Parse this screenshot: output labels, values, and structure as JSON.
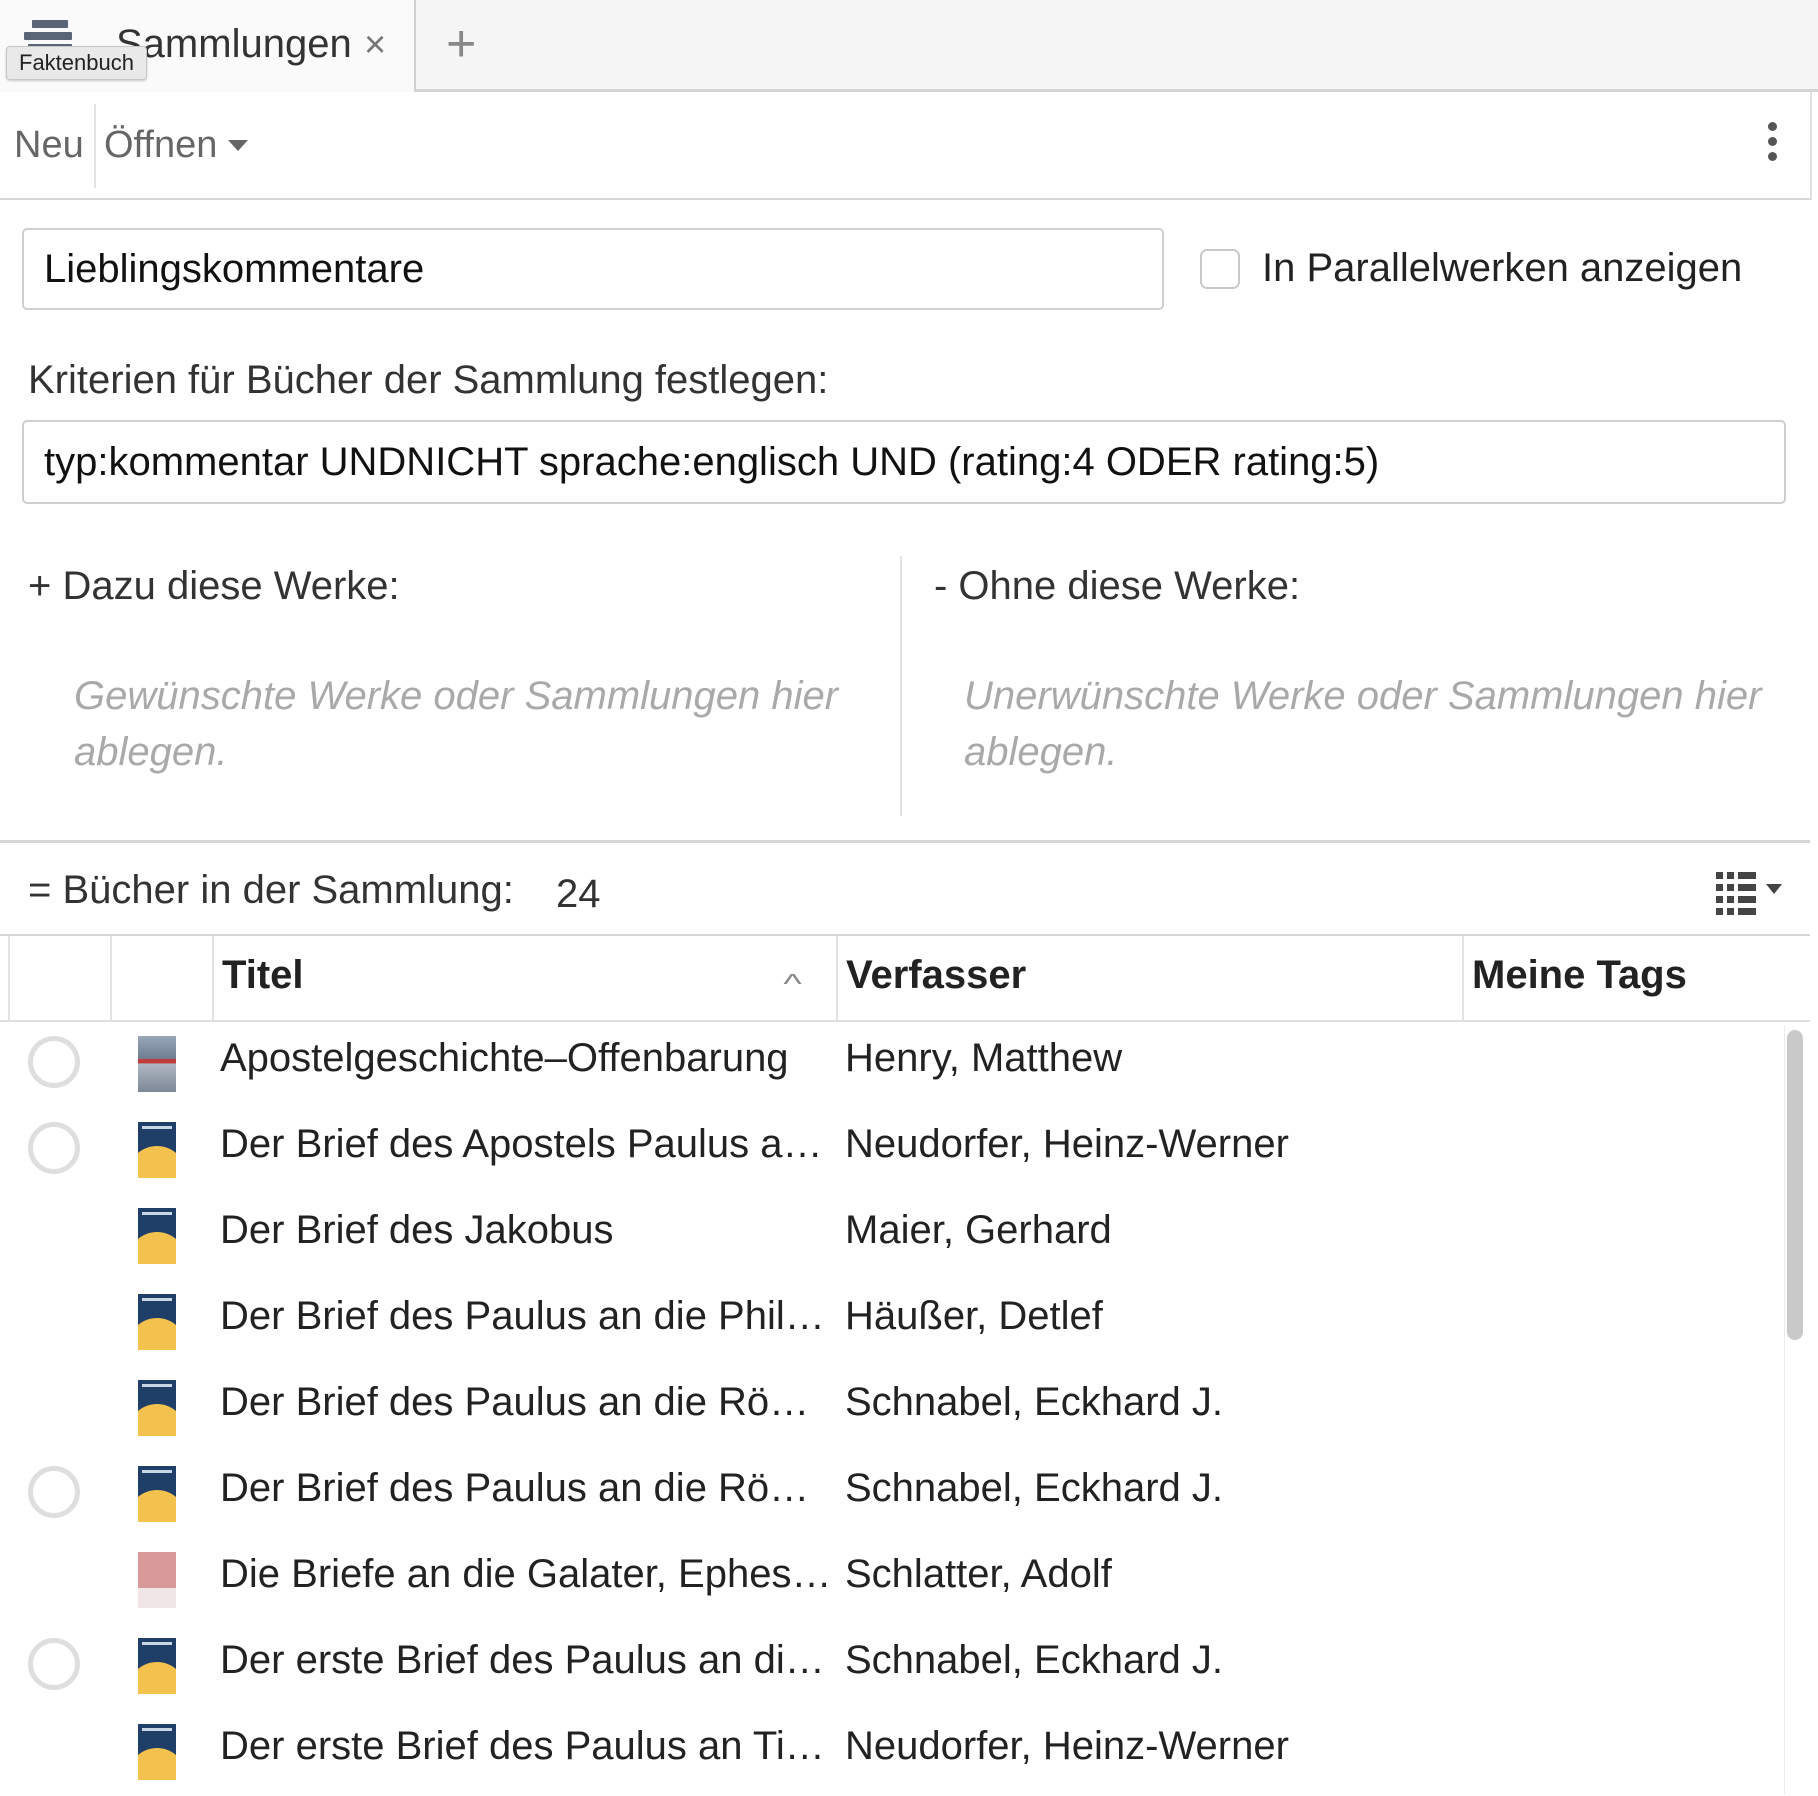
{
  "tab": {
    "icon": "books-icon",
    "label": "Sammlungen",
    "close_glyph": "×",
    "tooltip": "Faktenbuch",
    "add_glyph": "+"
  },
  "toolbar": {
    "new_label": "Neu",
    "open_label": "Öffnen",
    "more_icon": "kebab-menu-icon"
  },
  "collection": {
    "name": "Lieblingskommentare",
    "parallel_label": "In Parallelwerken anzeigen",
    "parallel_checked": false,
    "criteria_label": "Kriterien  für Bücher der Sammlung festlegen:",
    "criteria_value": "typ:kommentar UNDNICHT sprache:englisch UND (rating:4 ODER rating:5)"
  },
  "include": {
    "heading": "+ Dazu diese Werke:",
    "placeholder": "Gewünschte Werke oder Sammlungen hier ablegen."
  },
  "exclude": {
    "heading": "-  Ohne diese Werke:",
    "placeholder": "Unerwünschte Werke oder Sammlungen hier ablegen."
  },
  "books": {
    "label": "= Bücher in der Sammlung:",
    "count": "24",
    "view_icon": "list-view-icon"
  },
  "table": {
    "columns": [
      "Titel",
      "Verfasser",
      "Meine Tags"
    ],
    "sort_indicator": "^",
    "rows": [
      {
        "title": "Apostelgeschichte–Offenbarung",
        "author": "Henry, Matthew",
        "status": true,
        "cover": "photo"
      },
      {
        "title": "Der Brief des Apostels Paulus a…",
        "author": "Neudorfer, Heinz-Werner",
        "status": true,
        "cover": "blue"
      },
      {
        "title": "Der Brief des Jakobus",
        "author": "Maier, Gerhard",
        "status": false,
        "cover": "blue"
      },
      {
        "title": "Der Brief des Paulus an die Phil…",
        "author": "Häußer, Detlef",
        "status": false,
        "cover": "blue"
      },
      {
        "title": "Der Brief des Paulus an die Rö…",
        "author": "Schnabel, Eckhard J.",
        "status": false,
        "cover": "blue"
      },
      {
        "title": "Der Brief des Paulus an die Rö…",
        "author": "Schnabel, Eckhard J.",
        "status": true,
        "cover": "blue"
      },
      {
        "title": "Die Briefe an die Galater, Ephes…",
        "author": "Schlatter, Adolf",
        "status": false,
        "cover": "pink"
      },
      {
        "title": "Der erste Brief des Paulus an di…",
        "author": "Schnabel, Eckhard J.",
        "status": true,
        "cover": "blue"
      },
      {
        "title": "Der erste Brief des Paulus an Ti…",
        "author": "Neudorfer, Heinz-Werner",
        "status": false,
        "cover": "blue"
      }
    ]
  }
}
